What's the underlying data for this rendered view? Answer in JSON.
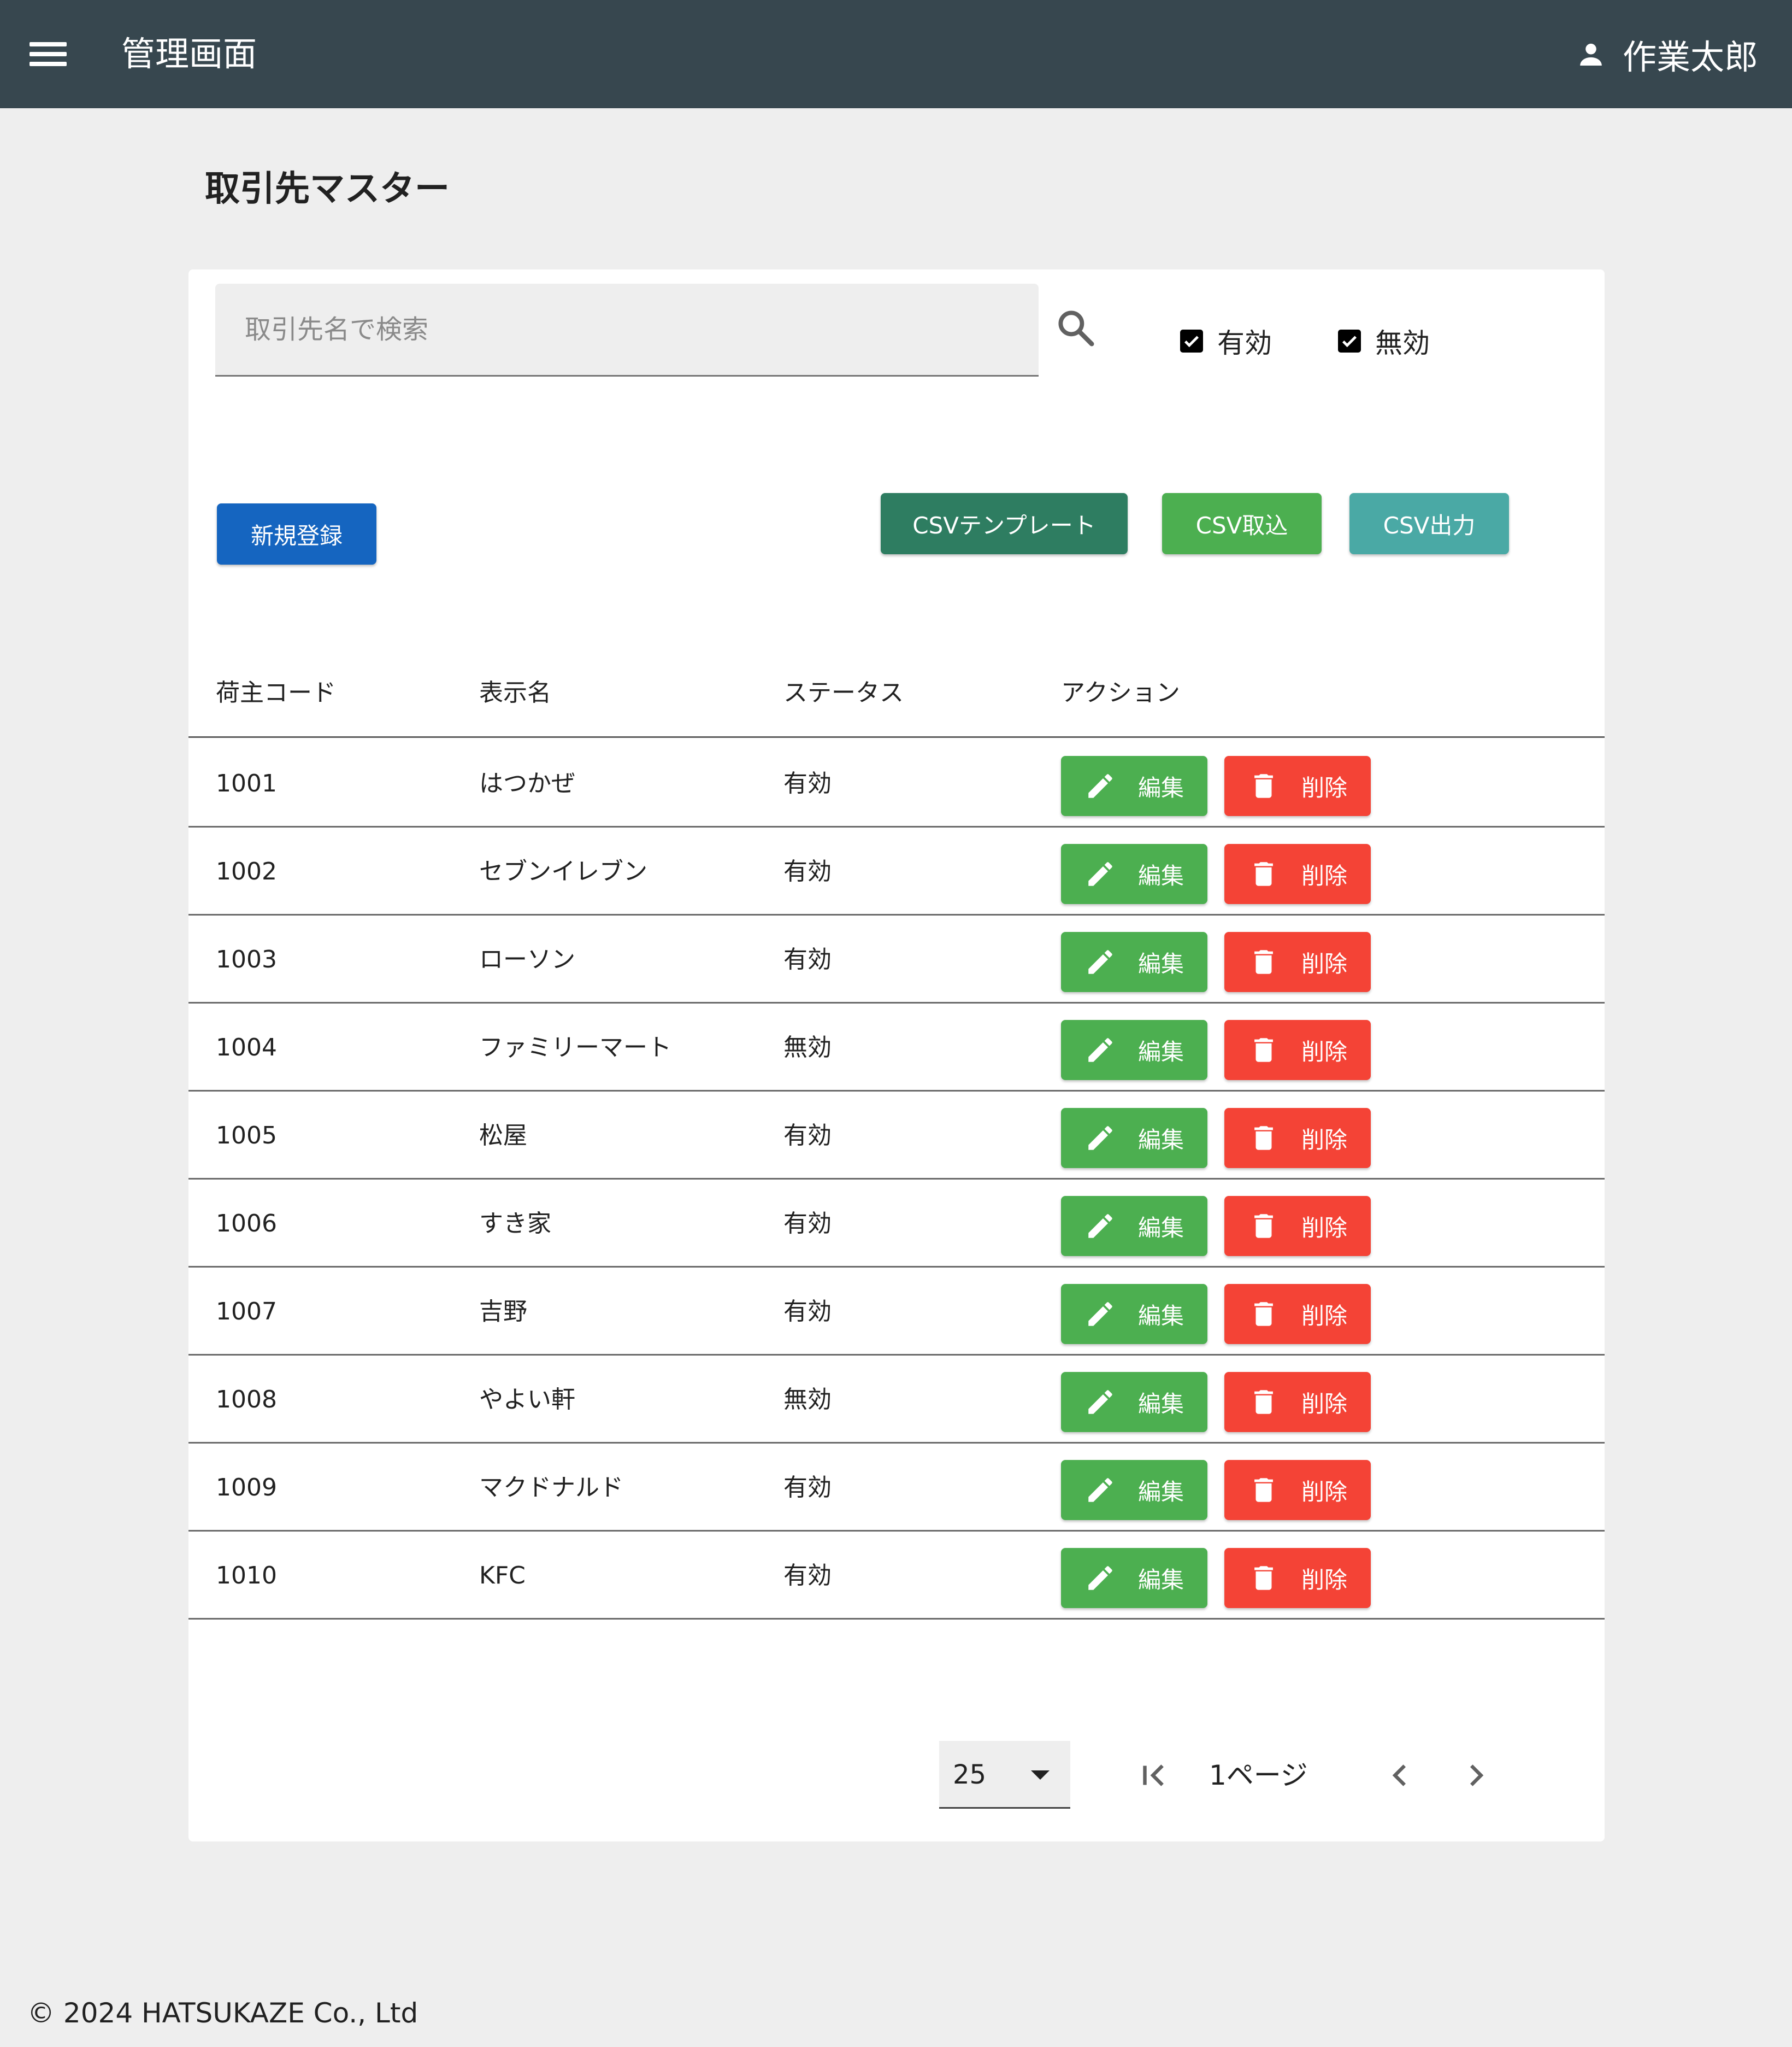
{
  "header": {
    "menu_icon": "menu-icon",
    "title": "管理画面",
    "user_icon": "person-icon",
    "user_name": "作業太郎",
    "color": "#37474f"
  },
  "page": {
    "title": "取引先マスター"
  },
  "search": {
    "placeholder": "取引先名で検索",
    "value": "",
    "icon": "search-icon"
  },
  "filters": [
    {
      "label": "有効",
      "checked": true
    },
    {
      "label": "無効",
      "checked": true
    }
  ],
  "toolbar": {
    "new_label": "新規登録",
    "csv_template_label": "CSVテンプレート",
    "csv_import_label": "CSV取込",
    "csv_export_label": "CSV出力"
  },
  "table": {
    "headers": [
      "荷主コード",
      "表示名",
      "ステータス",
      "アクション"
    ],
    "edit_label": "編集",
    "delete_label": "削除",
    "rows": [
      {
        "code": "1001",
        "name": "はつかぜ",
        "status": "有効"
      },
      {
        "code": "1002",
        "name": "セブンイレブン",
        "status": "有効"
      },
      {
        "code": "1003",
        "name": "ローソン",
        "status": "有効"
      },
      {
        "code": "1004",
        "name": "ファミリーマート",
        "status": "無効"
      },
      {
        "code": "1005",
        "name": "松屋",
        "status": "有効"
      },
      {
        "code": "1006",
        "name": "すき家",
        "status": "有効"
      },
      {
        "code": "1007",
        "name": "吉野",
        "status": "有効"
      },
      {
        "code": "1008",
        "name": "やよい軒",
        "status": "無効"
      },
      {
        "code": "1009",
        "name": "マクドナルド",
        "status": "有効"
      },
      {
        "code": "1010",
        "name": "KFC",
        "status": "有効"
      }
    ]
  },
  "pagination": {
    "rows_per_page": "25",
    "page_label": "1ページ",
    "icons": [
      "first-page-icon",
      "chevron-left-icon",
      "chevron-right-icon"
    ]
  },
  "footer": {
    "copyright": "© 2024 HATSUKAZE Co., Ltd"
  },
  "colors": {
    "primary": "#1565c0",
    "csv_template": "#2e7d61",
    "success": "#4caf50",
    "teal": "#4aa9a5",
    "danger": "#f44336"
  }
}
